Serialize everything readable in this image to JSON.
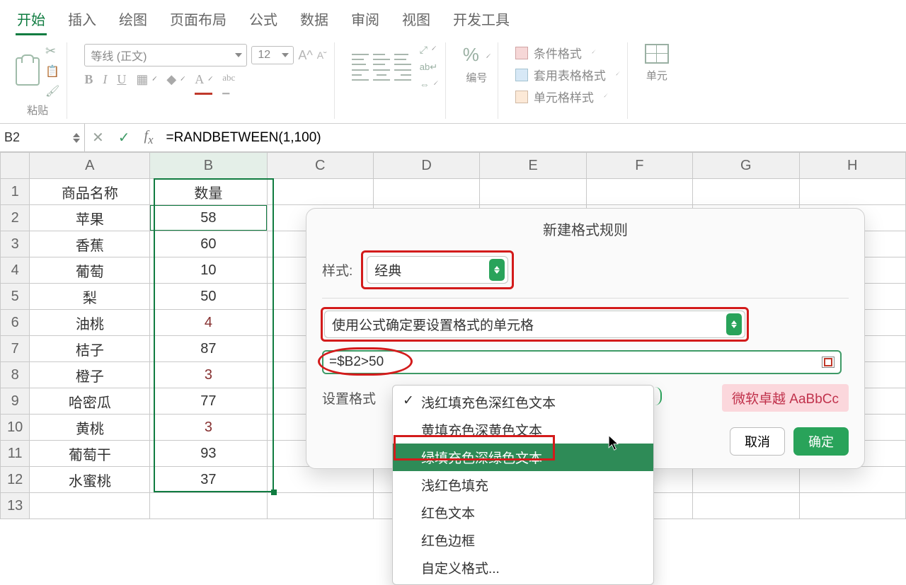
{
  "ribbon": {
    "tabs": [
      "开始",
      "插入",
      "绘图",
      "页面布局",
      "公式",
      "数据",
      "审阅",
      "视图",
      "开发工具"
    ],
    "active_tab": 0,
    "paste_label": "粘贴",
    "font_name": "等线 (正文)",
    "font_size": "12",
    "number_group_label": "编号",
    "cell_group_label": "单元",
    "cf": {
      "conditional": "条件格式",
      "tableformat": "套用表格格式",
      "cellstyle": "单元格样式"
    }
  },
  "formula_bar": {
    "cell_ref": "B2",
    "formula": "=RANDBETWEEN(1,100)"
  },
  "sheet": {
    "cols": [
      "A",
      "B",
      "C",
      "D",
      "E",
      "F",
      "G",
      "H"
    ],
    "headers": {
      "A": "商品名称",
      "B": "数量"
    },
    "rows": [
      {
        "n": "苹果",
        "q": "58",
        "red": false,
        "active": true
      },
      {
        "n": "香蕉",
        "q": "60",
        "red": false
      },
      {
        "n": "葡萄",
        "q": "10",
        "red": false
      },
      {
        "n": "梨",
        "q": "50",
        "red": false
      },
      {
        "n": "油桃",
        "q": "4",
        "red": true
      },
      {
        "n": "桔子",
        "q": "87",
        "red": false
      },
      {
        "n": "橙子",
        "q": "3",
        "red": true
      },
      {
        "n": "哈密瓜",
        "q": "77",
        "red": false
      },
      {
        "n": "黄桃",
        "q": "3",
        "red": true
      },
      {
        "n": "葡萄干",
        "q": "93",
        "red": false
      },
      {
        "n": "水蜜桃",
        "q": "37",
        "red": false
      }
    ]
  },
  "dialog": {
    "title": "新建格式规则",
    "style_label": "样式:",
    "style_value": "经典",
    "rule_type": "使用公式确定要设置格式的单元格",
    "formula": "=$B2>50",
    "format_with_label": "设置格式",
    "preview_text": "微软卓越 AaBbCc",
    "cancel": "取消",
    "ok": "确定"
  },
  "menu": {
    "items": [
      "浅红填充色深红色文本",
      "黄填充色深黄色文本",
      "绿填充色深绿色文本",
      "浅红色填充",
      "红色文本",
      "红色边框",
      "自定义格式..."
    ],
    "checked_index": 0,
    "highlighted_index": 2
  }
}
